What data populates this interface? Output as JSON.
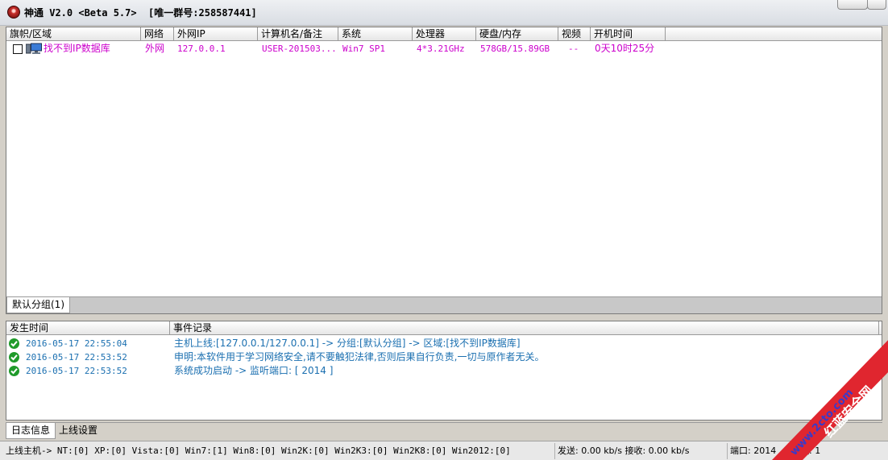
{
  "titlebar": {
    "title": "神通 V2.0 <Beta 5.7>  [唯一群号:258587441]"
  },
  "host_table": {
    "columns": [
      "旗帜/区域",
      "网络",
      "外网IP",
      "计算机名/备注",
      "系统",
      "处理器",
      "硬盘/内存",
      "视频",
      "开机时间"
    ],
    "rows": [
      {
        "region": "找不到IP数据库",
        "network": "外网",
        "ip": "127.0.0.1",
        "computer": "USER-201503...",
        "os": "Win7 SP1",
        "cpu": "4*3.21GHz",
        "disk_mem": "578GB/15.89GB",
        "video": "--",
        "uptime": "0天10时25分"
      }
    ],
    "group_tab": "默认分组(1)"
  },
  "log_table": {
    "columns": [
      "发生时间",
      "事件记录"
    ],
    "rows": [
      {
        "time": "2016-05-17 22:55:04",
        "event": "主机上线:[127.0.0.1/127.0.0.1] -> 分组:[默认分组] -> 区域:[找不到IP数据库]"
      },
      {
        "time": "2016-05-17 22:53:52",
        "event": "申明:本软件用于学习网络安全,请不要触犯法律,否则后果自行负责,一切与原作者无关。"
      },
      {
        "time": "2016-05-17 22:53:52",
        "event": "系统成功启动 -> 监听端口: [ 2014 ]"
      }
    ]
  },
  "bottom_tabs": [
    "日志信息",
    "上线设置"
  ],
  "statusbar": {
    "online_stats": "上线主机-> NT:[0] XP:[0] Vista:[0] Win7:[1] Win8:[0] Win2K:[0] Win2K3:[0] Win2K8:[0] Win2012:[0]",
    "traffic": "发送: 0.00 kb/s 接收: 0.00 kb/s",
    "port": "端口: 2014",
    "hosts": "主机: 1"
  },
  "watermark": {
    "line1": "www.2cto.com",
    "line2": "红蓝安全网"
  },
  "colors": {
    "accent_pink": "#cc00cc",
    "log_text": "#1a6fb0",
    "ok_green": "#1f9a2a",
    "watermark_red": "#e0262f"
  },
  "icons": [
    "app-logo-icon",
    "checkbox-icon",
    "monitor-icon",
    "check-circle-icon"
  ]
}
